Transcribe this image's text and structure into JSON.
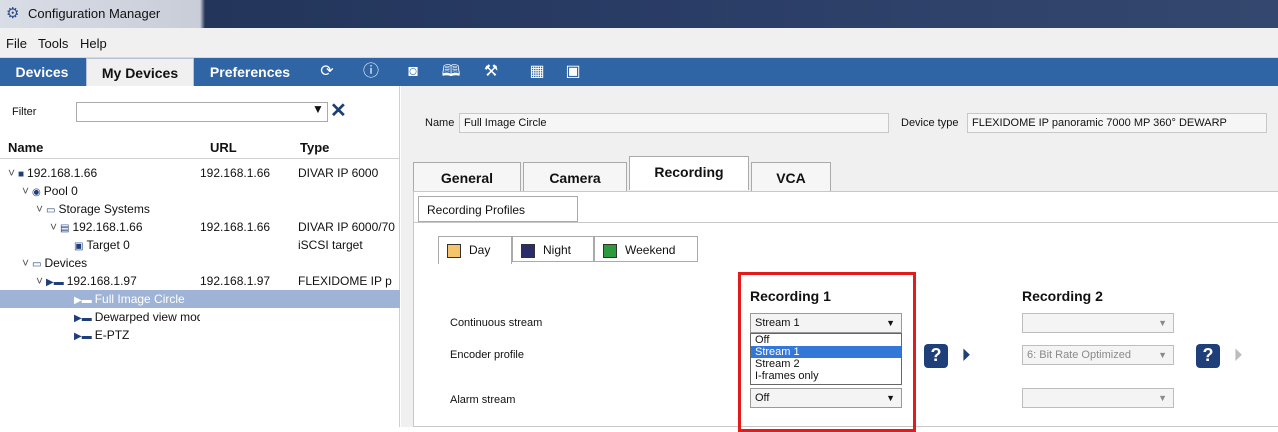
{
  "window": {
    "title": "Configuration Manager"
  },
  "menu": [
    "File",
    "Tools",
    "Help"
  ],
  "toolbar": {
    "tabs": [
      {
        "label": "Devices",
        "active": false
      },
      {
        "label": "My Devices",
        "active": true
      },
      {
        "label": "Preferences",
        "active": false
      }
    ],
    "icons": [
      "refresh-icon",
      "info-icon",
      "camera-snapshot-icon",
      "book-icon",
      "wrench-icon",
      "table-icon",
      "save-icon"
    ]
  },
  "filter": {
    "label": "Filter",
    "value": ""
  },
  "tree": {
    "headers": {
      "name": "Name",
      "url": "URL",
      "type": "Type"
    },
    "rows": [
      {
        "name": "192.168.1.66",
        "url": "192.168.1.66",
        "type": "DIVAR IP 6000",
        "indent": 0,
        "expand": "˅",
        "icon": "■"
      },
      {
        "name": "Pool 0",
        "url": "",
        "type": "",
        "indent": 1,
        "expand": "˅",
        "icon": "◉"
      },
      {
        "name": "Storage Systems",
        "url": "",
        "type": "",
        "indent": 2,
        "expand": "˅",
        "icon": "▭"
      },
      {
        "name": "192.168.1.66",
        "url": "192.168.1.66",
        "type": "DIVAR IP 6000/70",
        "indent": 3,
        "expand": "˅",
        "icon": "▤"
      },
      {
        "name": "Target 0",
        "url": "",
        "type": "iSCSI target",
        "indent": 4,
        "expand": "",
        "icon": "▣"
      },
      {
        "name": "Devices",
        "url": "",
        "type": "",
        "indent": 1,
        "expand": "˅",
        "icon": "▭"
      },
      {
        "name": "192.168.1.97",
        "url": "192.168.1.97",
        "type": "FLEXIDOME IP p",
        "indent": 2,
        "expand": "˅",
        "icon": "▶▬"
      },
      {
        "name": "Full Image Circle",
        "url": "",
        "type": "",
        "indent": 4,
        "expand": "",
        "icon": "▶▬",
        "selected": true
      },
      {
        "name": "Dewarped view mode",
        "url": "",
        "type": "",
        "indent": 4,
        "expand": "",
        "icon": "▶▬"
      },
      {
        "name": "E-PTZ",
        "url": "",
        "type": "",
        "indent": 4,
        "expand": "",
        "icon": "▶▬"
      }
    ]
  },
  "details": {
    "name_label": "Name",
    "name_value": "Full Image Circle",
    "device_type_label": "Device type",
    "device_type_value": "FLEXIDOME IP panoramic 7000 MP 360° DEWARP"
  },
  "tabs": [
    {
      "label": "General",
      "active": false
    },
    {
      "label": "Camera",
      "active": false
    },
    {
      "label": "Recording",
      "active": true
    },
    {
      "label": "VCA",
      "active": false
    }
  ],
  "subtab": {
    "label": "Recording Profiles"
  },
  "profiles": [
    {
      "label": "Day",
      "color": "#f5c46b",
      "active": true
    },
    {
      "label": "Night",
      "color": "#2b2d6b",
      "active": false
    },
    {
      "label": "Weekend",
      "color": "#2e9a3e",
      "active": false
    }
  ],
  "recording": {
    "rec1_header": "Recording 1",
    "rec2_header": "Recording 2",
    "labels": {
      "continuous": "Continuous stream",
      "encoder": "Encoder profile",
      "alarm": "Alarm stream"
    },
    "rec1": {
      "continuous_value": "Stream 1",
      "alarm_value": "Off",
      "dropdown_options": [
        "Off",
        "Stream 1",
        "Stream 2",
        "I-frames only"
      ],
      "dropdown_selected": "Stream 1"
    },
    "rec2": {
      "continuous_value": "",
      "encoder_value": "6: Bit Rate Optimized",
      "alarm_value": ""
    }
  },
  "colors": {
    "toolbar": "#2f64a5",
    "highlight": "#e31b1b",
    "selection": "#3377d8"
  }
}
